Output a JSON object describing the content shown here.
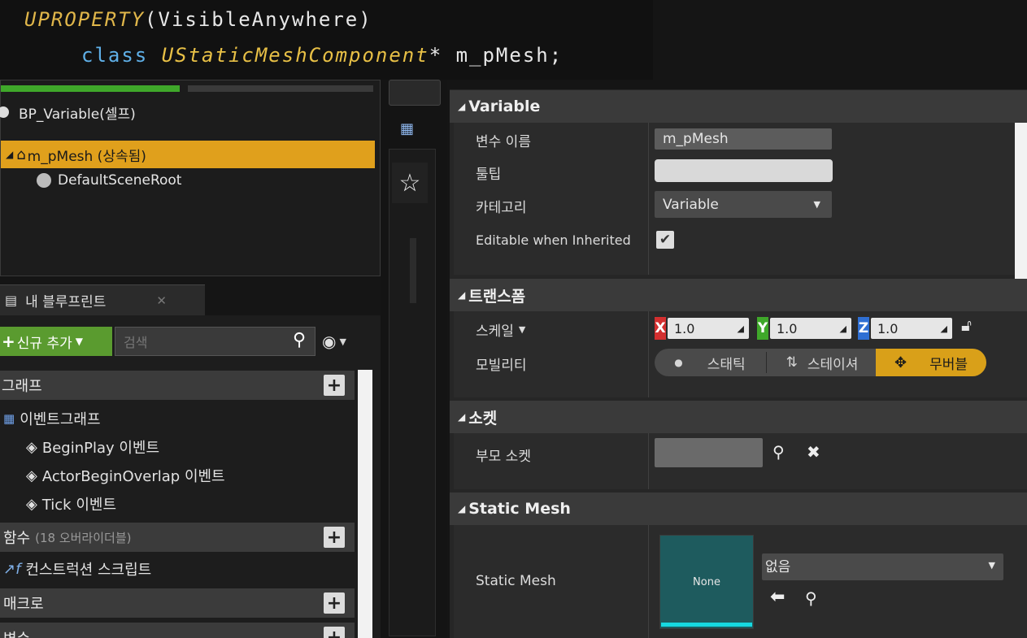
{
  "code": {
    "macro": "UPROPERTY",
    "macro_args": "(VisibleAnywhere)",
    "class_kw": "class",
    "type_name": "UStaticMeshComponent",
    "declaration": "* m_pMesh;"
  },
  "components": {
    "self_label": "BP_Variable(셀프)",
    "selected_label": "m_pMesh (상속됨)",
    "child_label": "DefaultSceneRoot"
  },
  "my_blueprint": {
    "tab_label": "내 블루프린트",
    "add_new_label": "신규 추가",
    "search_placeholder": "검색",
    "graphs_label": "그래프",
    "event_graph_label": "이벤트그래프",
    "events": [
      "BeginPlay 이벤트",
      "ActorBeginOverlap 이벤트",
      "Tick 이벤트"
    ],
    "functions_label": "함수",
    "functions_note": "(18 오버라이더블)",
    "construction_script_label": "컨스트럭션 스크립트",
    "macros_label": "매크로",
    "variables_label": "변수"
  },
  "details": {
    "variable": {
      "header": "Variable",
      "name_label": "변수 이름",
      "name_value": "m_pMesh",
      "tooltip_label": "툴팁",
      "tooltip_value": "",
      "category_label": "카테고리",
      "category_value": "Variable",
      "editable_label": "Editable when Inherited",
      "editable_checked": true
    },
    "transform": {
      "header": "트랜스폼",
      "scale_label": "스케일",
      "scale": {
        "x": "1.0",
        "y": "1.0",
        "z": "1.0"
      },
      "axis_x": "X",
      "axis_y": "Y",
      "axis_z": "Z",
      "mobility_label": "모빌리티",
      "mobility_static": "스태틱",
      "mobility_stationary": "스테이셔",
      "mobility_movable": "무버블",
      "mobility_selected": "무버블"
    },
    "socket": {
      "header": "소켓",
      "parent_socket_label": "부모 소켓",
      "parent_socket_value": ""
    },
    "static_mesh": {
      "header": "Static Mesh",
      "label": "Static Mesh",
      "thumbnail_text": "None",
      "dropdown_value": "없음"
    }
  },
  "colors": {
    "selected_row": "#e0a01c",
    "add_button": "#5a9b2f",
    "axis_x": "#d32f2f",
    "axis_y": "#3fa82a",
    "axis_z": "#2f6fd3",
    "movable": "#d9a019",
    "thumbnail": "#1e5b5e",
    "thumbnail_bar": "#16d8e0"
  }
}
